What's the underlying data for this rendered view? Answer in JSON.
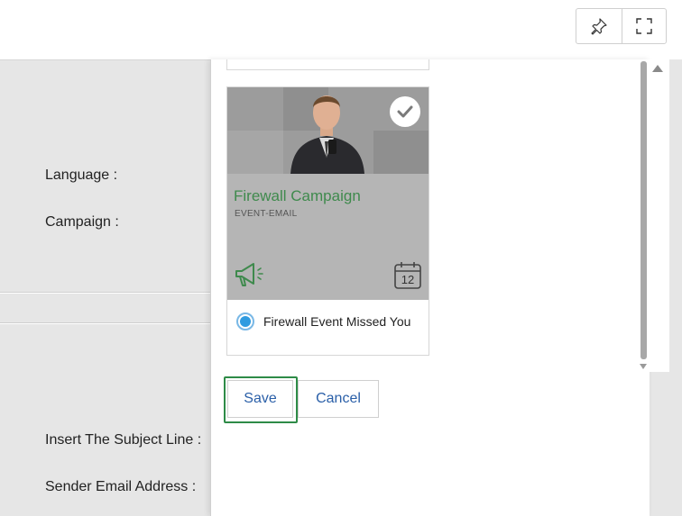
{
  "toolbar": {
    "pin_icon": "pin-icon",
    "fullscreen_icon": "fullscreen-icon"
  },
  "form": {
    "language_label": "Language :",
    "campaign_label": "Campaign :",
    "subject_label": "Insert The Subject Line :",
    "sender_label": "Sender Email Address :"
  },
  "card": {
    "title": "Firewall Campaign",
    "subtitle": "EVENT-EMAIL",
    "calendar_day": "12",
    "option_label": "Firewall Event Missed You",
    "title_color": "#3f8a4d"
  },
  "actions": {
    "save_label": "Save",
    "cancel_label": "Cancel",
    "link_color": "#2a5fa8"
  }
}
